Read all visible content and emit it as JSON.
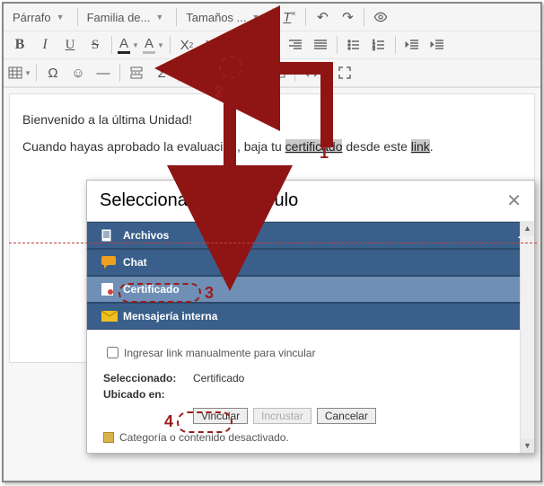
{
  "toolbar": {
    "paragraph": "Párrafo",
    "font_family": "Familia de...",
    "font_size": "Tamaños ..."
  },
  "editor": {
    "line1": "Bienvenido a la última Unidad!",
    "line2_a": "Cuando hayas aprobado la evaluación, baja tu ",
    "line2_cert": "certificado",
    "line2_b": " desde este ",
    "line2_link": "link",
    "line2_c": "."
  },
  "dialog": {
    "title": "Seleccionar Hipervínculo",
    "categories": {
      "archivos": "Archivos",
      "chat": "Chat",
      "certificado": "Certificado",
      "mensajeria": "Mensajería interna"
    },
    "manual_chk": "Ingresar link manualmente para vincular",
    "selected_label": "Seleccionado:",
    "selected_value": "Certificado",
    "located_label": "Ubicado en:",
    "btn_link": "Vincular",
    "btn_embed": "Incrustar",
    "btn_cancel": "Cancelar",
    "legend": "Categoría o contenido desactivado."
  },
  "steps": {
    "s1": "1",
    "s2": "2",
    "s3": "3",
    "s4": "4"
  }
}
